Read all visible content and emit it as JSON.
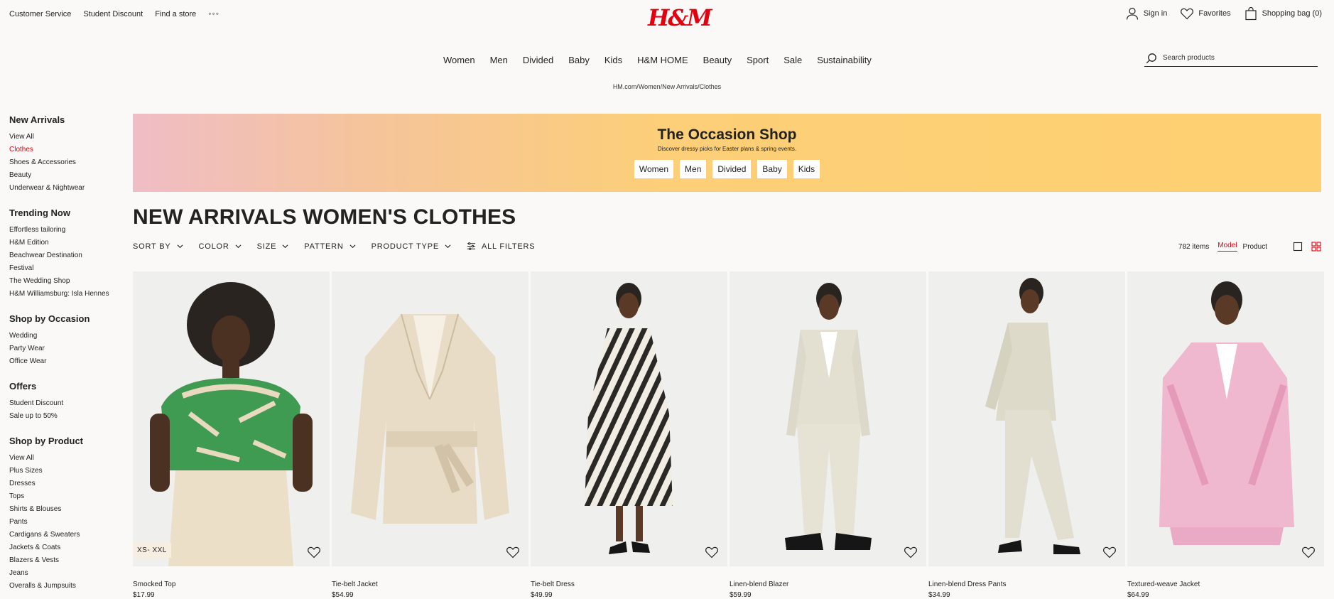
{
  "top_links": [
    "Customer Service",
    "Student Discount",
    "Find a store"
  ],
  "more_dots": "◦◦◦",
  "logo_text": "H&M",
  "account": {
    "sign_in": "Sign in",
    "favorites": "Favorites",
    "bag": "Shopping bag (0)"
  },
  "nav": [
    "Women",
    "Men",
    "Divided",
    "Baby",
    "Kids",
    "H&M HOME",
    "Beauty",
    "Sport",
    "Sale",
    "Sustainability"
  ],
  "search_placeholder": "Search products",
  "breadcrumb": "HM.com/Women/New Arrivals/Clothes",
  "sidebar": [
    {
      "heading": "New Arrivals",
      "items": [
        "View All",
        "Clothes",
        "Shoes & Accessories",
        "Beauty",
        "Underwear & Nightwear"
      ],
      "active": 1
    },
    {
      "heading": "Trending Now",
      "items": [
        "Effortless tailoring",
        "H&M Edition",
        "Beachwear Destination",
        "Festival",
        "The Wedding Shop",
        "H&M Williamsburg: Isla Hennes"
      ]
    },
    {
      "heading": "Shop by Occasion",
      "items": [
        "Wedding",
        "Party Wear",
        "Office Wear"
      ]
    },
    {
      "heading": "Offers",
      "items": [
        "Student Discount",
        "Sale up to 50%"
      ]
    },
    {
      "heading": "Shop by Product",
      "items": [
        "View All",
        "Plus Sizes",
        "Dresses",
        "Tops",
        "Shirts & Blouses",
        "Pants",
        "Cardigans & Sweaters",
        "Jackets & Coats",
        "Blazers & Vests",
        "Jeans",
        "Overalls & Jumpsuits"
      ]
    }
  ],
  "banner": {
    "title": "The Occasion Shop",
    "subtitle": "Discover dressy picks for Easter plans & spring events.",
    "links": [
      "Women",
      "Men",
      "Divided",
      "Baby",
      "Kids"
    ]
  },
  "page_title": "NEW ARRIVALS WOMEN'S CLOTHES",
  "filters": [
    "SORT BY",
    "COLOR",
    "SIZE",
    "PATTERN",
    "PRODUCT TYPE"
  ],
  "all_filters": "ALL FILTERS",
  "item_count": "782 items",
  "view_model": "Model",
  "view_product": "Product",
  "colors": {
    "brand_red": "#e50010"
  },
  "products": [
    {
      "name": "Smocked Top",
      "price": "$17.99",
      "badge": "XS- XXL"
    },
    {
      "name": "Tie-belt Jacket",
      "price": "$54.99",
      "badge": ""
    },
    {
      "name": "Tie-belt Dress",
      "price": "$49.99",
      "badge": ""
    },
    {
      "name": "Linen-blend Blazer",
      "price": "$59.99",
      "badge": ""
    },
    {
      "name": "Linen-blend Dress Pants",
      "price": "$34.99",
      "badge": ""
    },
    {
      "name": "Textured-weave Jacket",
      "price": "$64.99",
      "badge": ""
    }
  ]
}
